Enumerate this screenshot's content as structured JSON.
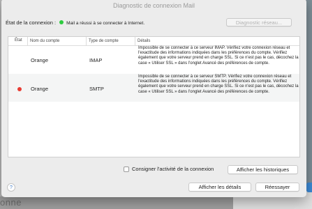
{
  "window": {
    "title": "Diagnostic de connexion Mail"
  },
  "status": {
    "label": "État de la connexion :",
    "text": "Mail a réussi à se connecter à Internet.",
    "color": "#2ecc40"
  },
  "buttons": {
    "network_diagnostics": "Diagnostic réseau...",
    "show_logs": "Afficher les historiques",
    "show_details": "Afficher les détails",
    "retry": "Réessayer"
  },
  "checkbox": {
    "label": "Consigner l'activité de la connexion",
    "checked": false
  },
  "table": {
    "headers": {
      "state": "État",
      "account": "Nom du compte",
      "type": "Type de compte",
      "details": "Détails"
    },
    "rows": [
      {
        "status": "ok",
        "account": "Orange",
        "type": "IMAP",
        "details": "Impossible de se connecter à ce serveur IMAP. Vérifiez votre connexion réseau et l'exactitude des informations indiquées dans les préférences du compte. Vérifiez également que votre serveur prend en charge SSL. Si ce n'est pas le cas, décochez la case « Utiliser SSL » dans l'onglet Avancé des préférences de compte."
      },
      {
        "status": "error",
        "account": "Orange",
        "type": "SMTP",
        "details": "Impossible de se connecter à ce serveur SMTP. Vérifiez votre connexion réseau et l'exactitude des informations indiquées dans les préférences du compte. Vérifiez également que votre serveur prend en charge SSL. Si ce n'est pas le cas, décochez la case « Utiliser SSL » dans l'onglet Avancé des préférences de compte."
      }
    ],
    "error_color": "#e83c33"
  },
  "help": {
    "icon": "question-mark-icon",
    "glyph": "?"
  },
  "background": {
    "partial_text": "onne"
  }
}
